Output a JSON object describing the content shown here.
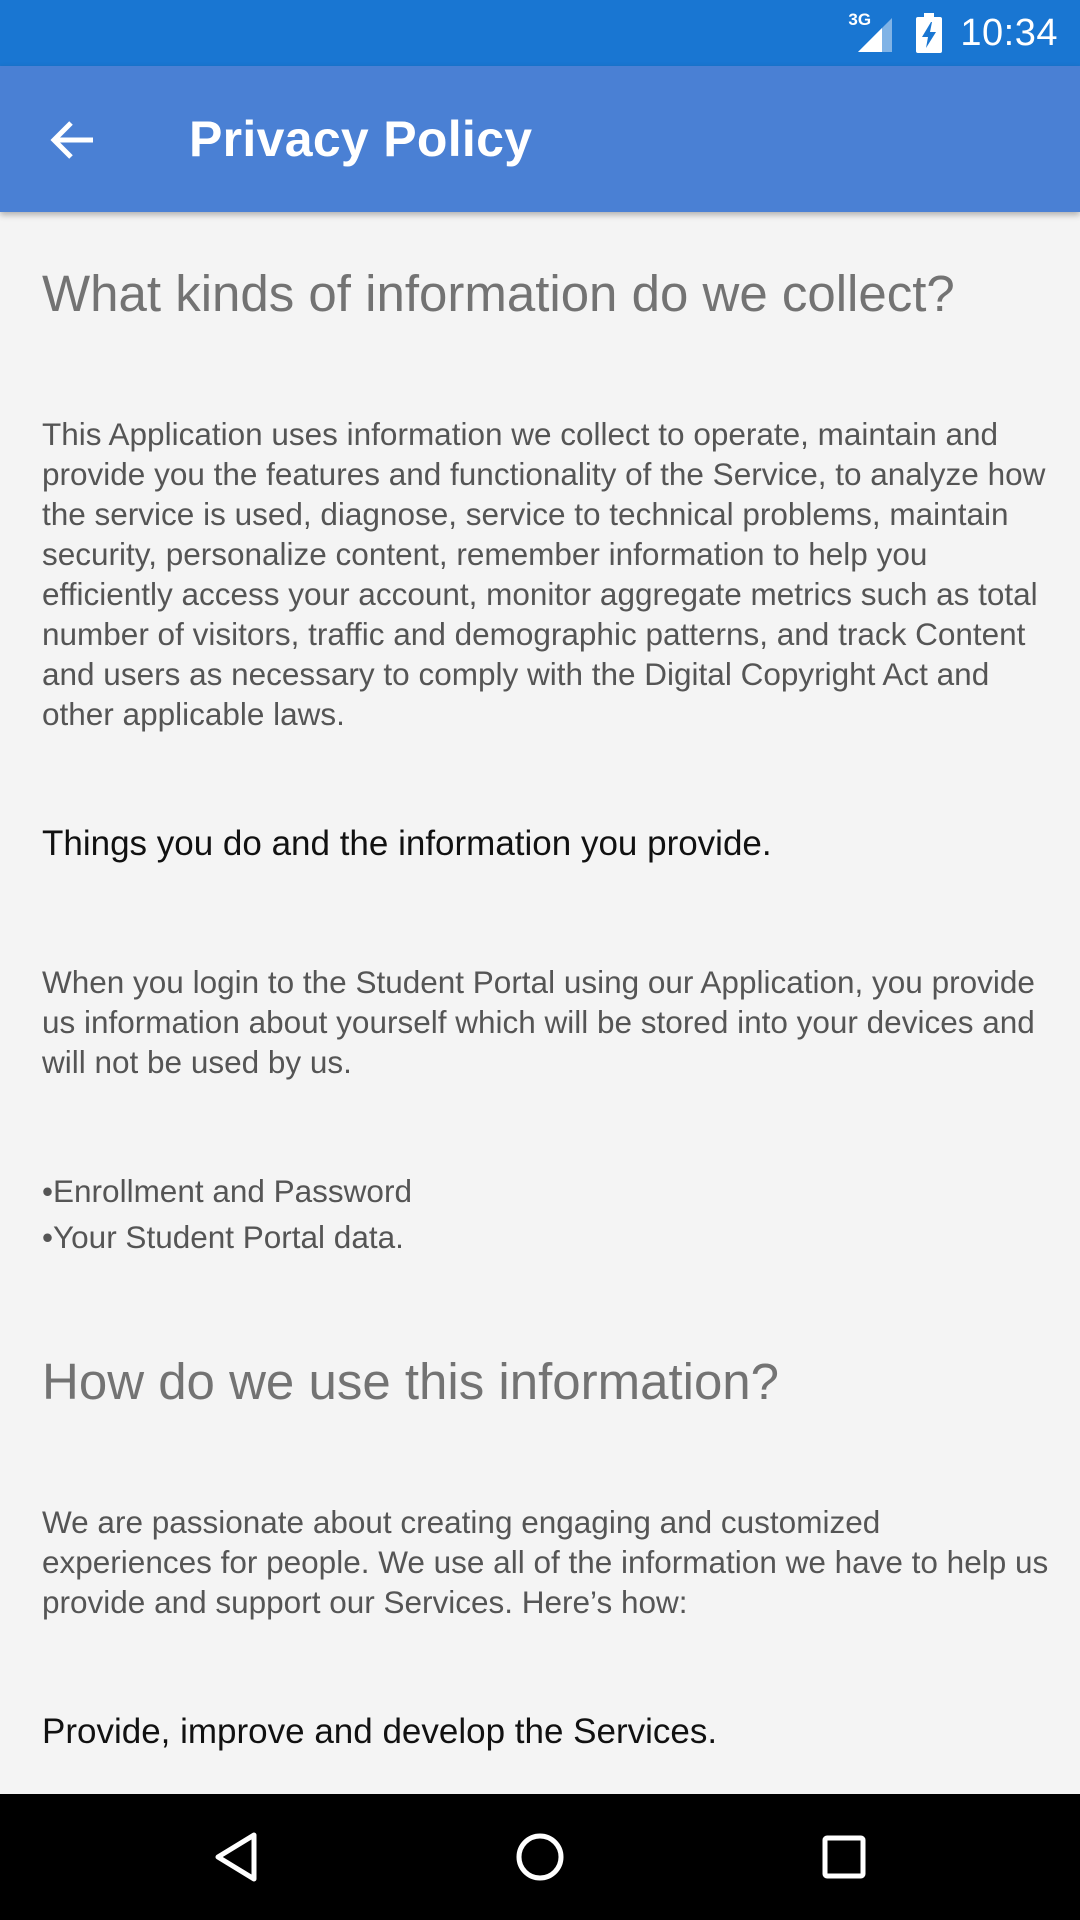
{
  "status_bar": {
    "network": "3G",
    "time": "10:34"
  },
  "app_bar": {
    "title": "Privacy Policy",
    "back_icon": "arrow-back-icon"
  },
  "content": {
    "heading_1": "What kinds of information do we collect?",
    "paragraph_1": "This Application uses information we collect to operate, maintain and provide you the features and functionality of the Service, to analyze how the service is used, diagnose, service to technical problems, maintain security, personalize content, remember information to help you efficiently access your account, monitor aggregate metrics such as total number of visitors, traffic and demographic patterns, and track Content and users as necessary to comply with the Digital Copyright Act and other applicable laws.",
    "subheading_1": "Things you do and the information you provide.",
    "paragraph_2": "When you login to the Student Portal using our Application, you provide us information about yourself which will be stored into your devices and will not be used by us.",
    "bullets": [
      "Enrollment and Password",
      "Your Student Portal data."
    ],
    "heading_2": "How do we use this information?",
    "paragraph_3": "We are passionate about creating engaging and customized experiences for people. We use all of the information we have to help us provide and support our Services. Here’s how:",
    "subheading_2": "Provide, improve and develop the Services."
  },
  "nav_bar": {
    "back": "nav-back-icon",
    "home": "nav-home-icon",
    "recents": "nav-recents-icon"
  },
  "colors": {
    "status_bar": "#1976d2",
    "app_bar": "#4a80d4",
    "background": "#f4f4f4",
    "heading": "#737373",
    "body_text": "#555555",
    "subheading": "#111111"
  }
}
